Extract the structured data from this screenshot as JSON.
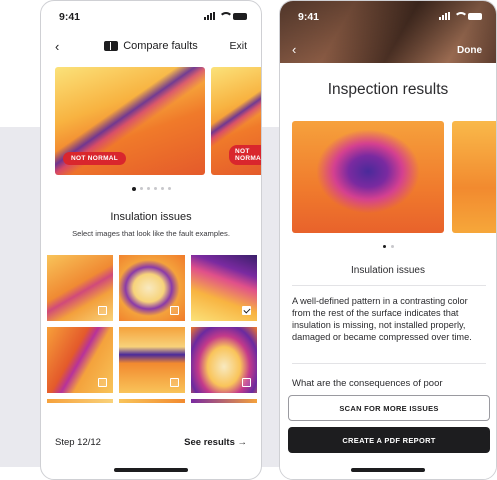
{
  "status": {
    "time": "9:41"
  },
  "left_screen": {
    "nav": {
      "back_icon": "chevron-left-icon",
      "title_icon": "compare-icon",
      "title": "Compare faults",
      "exit_label": "Exit"
    },
    "carousel": {
      "main_tag": "NOT NORMAL",
      "next_tag": "NOT NORMAL",
      "dots_total": 6,
      "dots_active": 0
    },
    "heading": "Insulation issues",
    "subheading": "Select images that look like the fault examples.",
    "grid_checked": [
      false,
      false,
      true,
      false,
      false,
      false,
      false,
      false,
      false
    ],
    "footer": {
      "step": "Step 12/12",
      "see_results": "See results",
      "arrow_icon": "arrow-right-icon"
    }
  },
  "right_screen": {
    "nav": {
      "back_icon": "chevron-left-icon",
      "done_label": "Done"
    },
    "title": "Inspection results",
    "dots_total": 2,
    "dots_active": 0,
    "heading": "Insulation issues",
    "description": "A well-defined pattern in a contrasting color from the rest of the surface indicates that insulation is missing, not installed properly, damaged or became compressed over time.",
    "question": "What are the consequences of poor",
    "buttons": {
      "scan": "SCAN FOR MORE ISSUES",
      "report": "CREATE A PDF REPORT"
    }
  },
  "colors": {
    "accent_red": "#d9262d",
    "dark": "#1d1d1f",
    "thermal_orange": "#f07a2a",
    "thermal_purple": "#4a2a9a"
  }
}
